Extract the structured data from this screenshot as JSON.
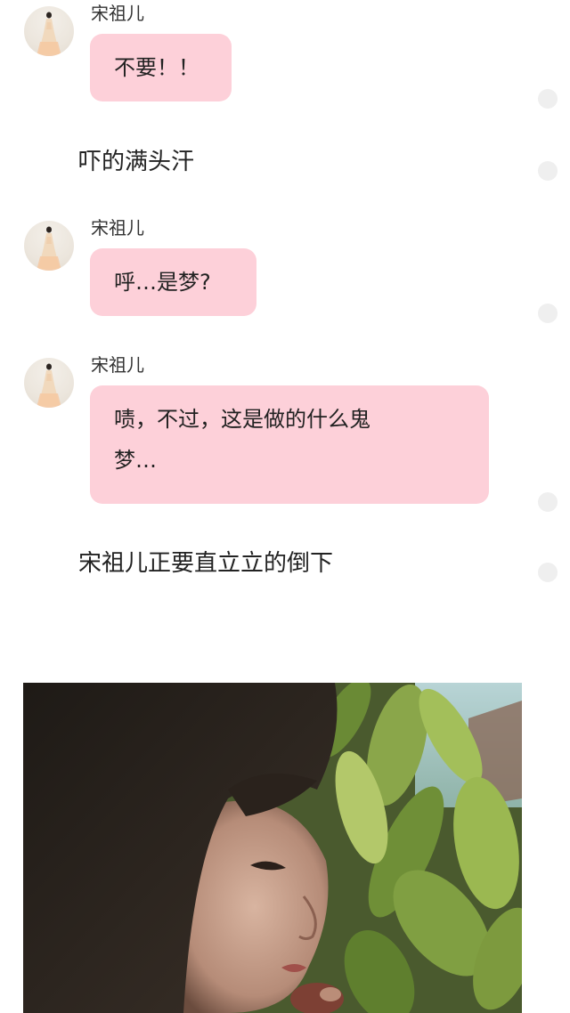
{
  "thread": {
    "messages": [
      {
        "type": "bubble",
        "sender": "宋祖儿",
        "text": "不要！！"
      },
      {
        "type": "narration",
        "text": "吓的满头汗"
      },
      {
        "type": "bubble",
        "sender": "宋祖儿",
        "text": "呼…是梦?"
      },
      {
        "type": "bubble",
        "sender": "宋祖儿",
        "text_line1": "啧，不过，这是做的什么鬼",
        "text_line2": "梦…"
      },
      {
        "type": "narration",
        "text": "宋祖儿正要直立立的倒下"
      },
      {
        "type": "image",
        "subject": "girl-portrait-with-leaves"
      }
    ]
  },
  "colors": {
    "bubble_bg": "#fdd0d9",
    "text": "#222222",
    "indicator_dot": "#efefef",
    "page_bg": "#ffffff"
  },
  "icons": {
    "avatar": "girl-in-dress-avatar",
    "status_dot": "status-dot-icon"
  }
}
